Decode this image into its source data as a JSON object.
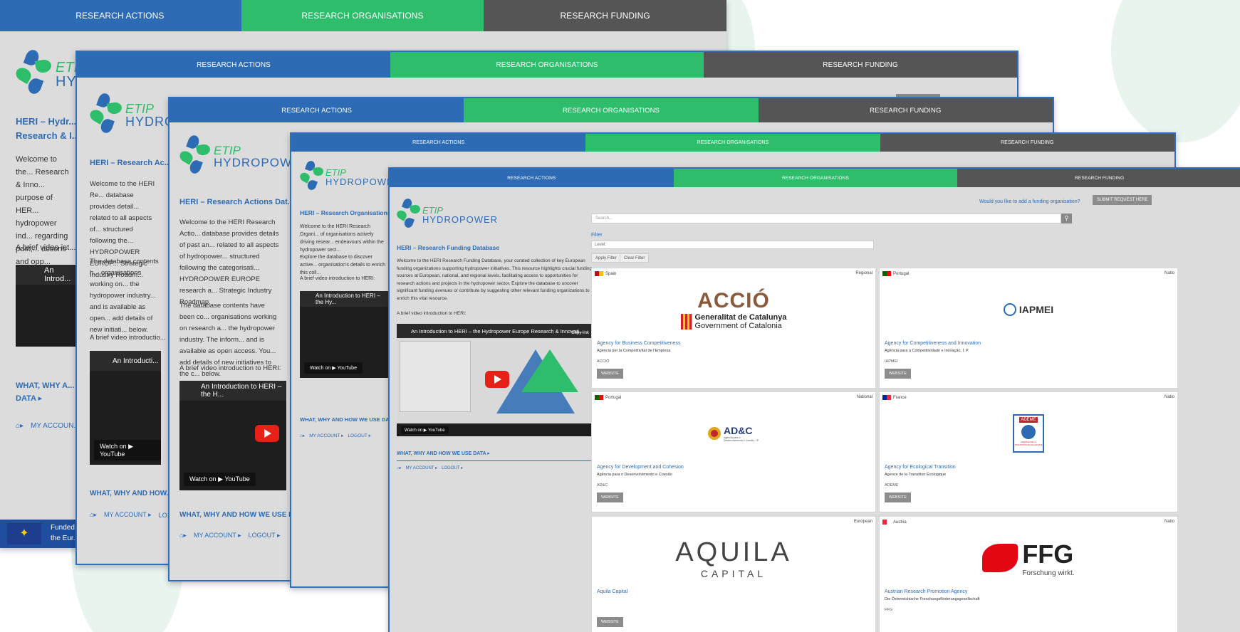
{
  "nav": {
    "actions": "RESEARCH ACTIONS",
    "organisations": "RESEARCH ORGANISATIONS",
    "funding": "RESEARCH FUNDING"
  },
  "logo": {
    "etip": "ETIP",
    "hydro": "HYDROPOWER"
  },
  "windows": {
    "w1": {
      "title": "HERI – Hydr...",
      "title2": "Research & I...",
      "intro": "Welcome to the... Research & Inno... purpose of HER... hydropower ind... regarding past,... actions and opp...",
      "video_hint": "A brief video int...",
      "video_title": "An Introd...",
      "links": "WHAT, WHY A...",
      "links2": "DATA ▸",
      "account": "MY ACCOUN...",
      "eu_funded": "Funded...",
      "eu_funded2": "the Eur..."
    },
    "w2": {
      "title": "HERI – Research Ac...",
      "intro": "Welcome to the HERI Re... database provides detail... related to all aspects of... structured following the... HYDROPOWER EUROP... Strategic Industry Roadm...",
      "intro2": "The database contents h... organisations working on... the hydropower industry... and is available as open... add details of new initiati... below.",
      "video_hint": "A brief video introductio...",
      "video_title": "An Introducti...",
      "yt": "Watch on ▶ YouTube",
      "links": "WHAT, WHY AND HOW...",
      "account": "MY ACCOUNT ▸",
      "logout": "LO..."
    },
    "w3": {
      "title": "HERI – Research Actions Dat...",
      "intro": "Welcome to the HERI Research Actio... database provides details of past an... related to all aspects of hydropower... structured following the categorisati... HYDROPOWER EUROPE research a... Strategic Industry Roadmap.",
      "intro2": "The database contents have been co... organisations working on research a... the hydropower industry. The inform... and is available as open access. You... add details of new initiatives to the c... below.",
      "video_hint": "A brief video introduction to HERI:",
      "video_title": "An Introduction to HERI – the H...",
      "yt": "Watch on ▶ YouTube",
      "links": "WHAT, WHY AND HOW WE USE D...",
      "account": "MY ACCOUNT ▸",
      "logout": "LOGOUT ▸"
    },
    "w4": {
      "title": "HERI – Research Organisations...",
      "intro": "Welcome to the HERI Research Organi... of organisations actively driving resear... endeavours within the hydropower sect...",
      "intro2": "Explore the database to discover active... organisation's details to enrich this coll...",
      "video_hint": "A brief video introduction to HERI:",
      "video_title": "An Introduction to HERI – the Hy...",
      "yt": "Watch on ▶ YouTube",
      "links": "WHAT, WHY AND HOW WE USE DAT...",
      "account": "MY ACCOUNT ▸",
      "logout": "LOGOUT ▸"
    },
    "w5": {
      "title": "HERI – Research Funding Database",
      "intro": "Welcome to the HERI Research Funding Database, your curated collection of key European funding organizations supporting hydropower initiatives. This resource highlights crucial funding sources at European, national, and regional levels, facilitating access to opportunities for research actions and projects in the hydropower sector. Explore the database to uncover significant funding avenues or contribute by suggesting other relevant funding organizations to enrich this vital resource.",
      "video_hint": "A brief video introduction to HERI:",
      "video_title": "An Introduction to HERI – the Hydropower Europe Research & Innovati...",
      "copy_link": "Copy link",
      "yt": "Watch on ▶ YouTube",
      "links": "WHAT, WHY AND HOW WE USE DATA ▸",
      "account": "MY ACCOUNT ▸",
      "logout": "LOGOUT ▸",
      "fund_question": "Would you like to add a funding organisation?",
      "submit": "SUBMIT REQUEST HERE",
      "search_placeholder": "Search...",
      "filter": "Filter",
      "level": "Level:",
      "apply": "Apply Filter",
      "clear": "Clear Filter"
    }
  },
  "cards": [
    {
      "country": "Spain",
      "scope": "Regional",
      "name": "Agency for Business Competitiveness",
      "local": "Agència per la Competitivitat de l'Empresa",
      "abbr": "ACCIÓ",
      "logo1": "ACCIÓ",
      "logo2": "Generalitat de Catalunya",
      "logo3": "Government of Catalonia",
      "website": "WEBSITE"
    },
    {
      "country": "Portugal",
      "scope": "Natio",
      "name": "Agency for Competitiveness and Innovation",
      "local": "Agência para a Competitividade e Inovação, I. P.",
      "abbr": "IAPMEI",
      "logo1": "IAPMEI",
      "website": "WEBSITE"
    },
    {
      "country": "Portugal",
      "scope": "National",
      "name": "Agency for Development and Cohesion",
      "local": "Agência para o Desenvolvimento e Coesão",
      "abbr": "AD&C",
      "logo1": "AD&C",
      "logo2": "Agência para o Desenvolvimento e Coesão, I.P.",
      "website": "WEBSITE"
    },
    {
      "country": "France",
      "scope": "Natio",
      "name": "Agency for Ecological Transition",
      "local": "Agence de la Transition Écologique",
      "abbr": "ADEME",
      "logo1": "ADEME",
      "logo2": "AGENCE DE LA TRANSITION ÉCOLOGIQUE",
      "website": "WEBSITE"
    },
    {
      "country": "",
      "scope": "European",
      "name": "Aquila Capital",
      "local": "",
      "abbr": "",
      "logo1": "AQUILA",
      "logo2": "CAPITAL",
      "website": "WEBSITE"
    },
    {
      "country": "Austria",
      "scope": "Natio",
      "name": "Austrian Research Promotion Agency",
      "local": "Die Österreichische Forschungsförderungsgesellschaft",
      "abbr": "FFG",
      "logo1": "FFG",
      "logo2": "Forschung wirkt.",
      "website": ""
    }
  ],
  "colors": {
    "blue": "#2d6bb5",
    "green": "#2ebd6b",
    "grey": "#555555"
  }
}
